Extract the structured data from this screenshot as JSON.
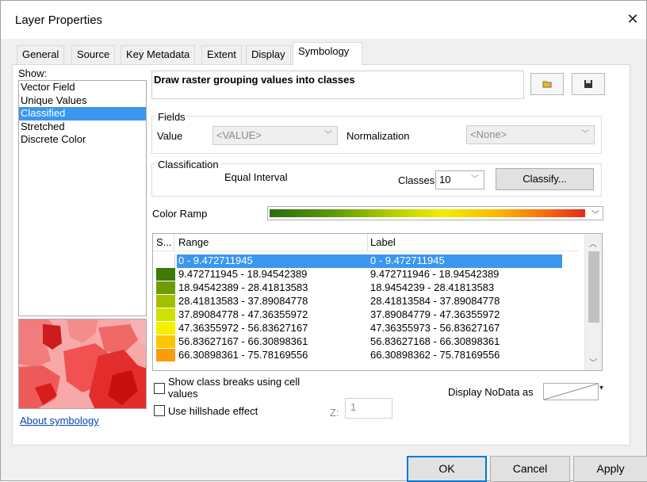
{
  "window": {
    "title": "Layer Properties",
    "close_glyph": "✕"
  },
  "tabs": [
    {
      "label": "General"
    },
    {
      "label": "Source"
    },
    {
      "label": "Key Metadata"
    },
    {
      "label": "Extent"
    },
    {
      "label": "Display"
    },
    {
      "label": "Symbology"
    }
  ],
  "active_tab": "Symbology",
  "show": {
    "label": "Show:",
    "items": [
      "Vector Field",
      "Unique Values",
      "Classified",
      "Stretched",
      "Discrete Color"
    ],
    "selected": "Classified"
  },
  "about_link": "About symbology",
  "description": "Draw raster grouping values into classes",
  "icons": {
    "import": "folder-open-icon",
    "save": "save-icon"
  },
  "fields": {
    "group_label": "Fields",
    "value_label": "Value",
    "value_selected": "<VALUE>",
    "normalization_label": "Normalization",
    "normalization_selected": "<None>"
  },
  "classification": {
    "group_label": "Classification",
    "method": "Equal Interval",
    "classes_label": "Classes",
    "classes_value": "10",
    "classify_button": "Classify..."
  },
  "color_ramp": {
    "label": "Color Ramp",
    "colors": [
      "#2d6b10",
      "#5a9a08",
      "#b9d000",
      "#f3ec00",
      "#fcb800",
      "#f66a10",
      "#e6281c"
    ]
  },
  "grid": {
    "headers": {
      "symbol": "S...",
      "range": "Range",
      "label": "Label"
    },
    "rows": [
      {
        "color": "#ffffff",
        "range": "0 - 9.472711945",
        "label": "0 - 9.472711945",
        "selected": true
      },
      {
        "color": "#3f7a07",
        "range": "9.472711945 - 18.94542389",
        "label": "9.472711946 - 18.94542389"
      },
      {
        "color": "#6f9c06",
        "range": "18.94542389 - 28.41813583",
        "label": "18.9454239 - 28.41813583"
      },
      {
        "color": "#a3c100",
        "range": "28.41813583 - 37.89084778",
        "label": "28.41813584 - 37.89084778"
      },
      {
        "color": "#cde200",
        "range": "37.89084778 - 47.36355972",
        "label": "37.89084779 - 47.36355972"
      },
      {
        "color": "#f6ef00",
        "range": "47.36355972 - 56.83627167",
        "label": "47.36355973 - 56.83627167"
      },
      {
        "color": "#fdc500",
        "range": "56.83627167 - 66.30898361",
        "label": "56.83627168 - 66.30898361"
      },
      {
        "color": "#fb9c0e",
        "range": "66.30898361 - 75.78169556",
        "label": "66.30898362 - 75.78169556"
      }
    ]
  },
  "options": {
    "show_breaks_label_1": "Show class breaks using cell",
    "show_breaks_label_2": "values",
    "hillshade_label": "Use hillshade effect",
    "z_label": "Z:",
    "z_value": "1",
    "nodata_label": "Display NoData as"
  },
  "buttons": {
    "ok": "OK",
    "cancel": "Cancel",
    "apply": "Apply"
  }
}
